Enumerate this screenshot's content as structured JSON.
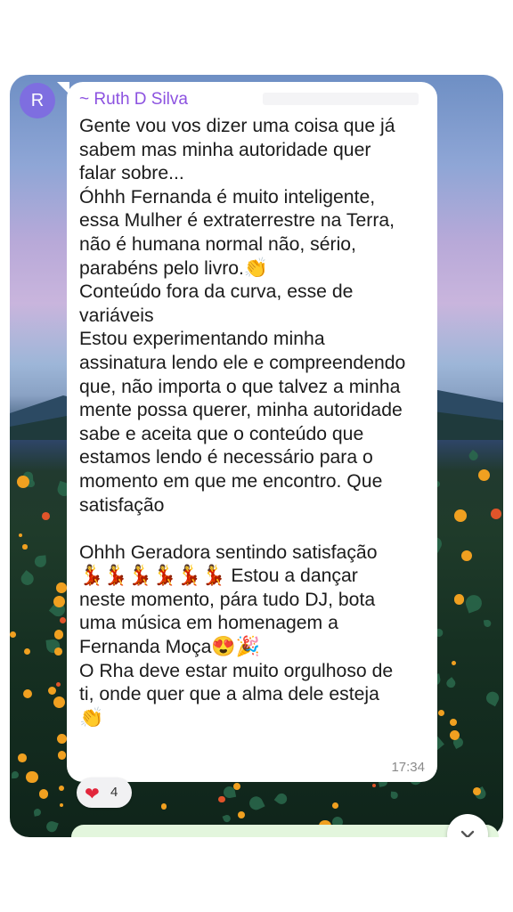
{
  "chat": {
    "avatar_initial": "R",
    "sender": "~ Ruth D Silva",
    "message_paragraphs": [
      "Gente vou vos dizer uma coisa que já\nsabem mas minha autoridade quer\nfalar sobre...",
      "Óhhh Fernanda é muito inteligente,\nessa Mulher é extraterrestre na Terra,\nnão é humana normal não, sério,\nparabéns pelo livro.",
      "Conteúdo fora da curva, esse de\nvariáveis",
      "Estou experimentando minha\nassinatura lendo ele e compreendendo\nque, não importa o que talvez a minha\nmente possa querer, minha autoridade\nsabe e aceita que o conteúdo que\nestamos lendo é necessário para o\nmomento em que me encontro. Que\nsatisfação",
      "",
      "Ohhh Geradora sentindo satisfação",
      " Estou a dançar\nneste momento, pára tudo DJ, bota\numa música em homenagem a\nFernanda Moça",
      "O Rha deve estar muito orgulhoso de\nti, onde quer que a alma dele esteja"
    ],
    "emoji": {
      "clap": "👏",
      "dancer": "💃",
      "heart_eyes": "😍",
      "party": "🎉"
    },
    "time": "17:34",
    "reaction": {
      "icon": "red-heart-icon",
      "emoji": "❤",
      "count": "4"
    }
  },
  "colors": {
    "sender": "#8c52e0",
    "avatar": "#7e6ee0",
    "bubble": "#ffffff",
    "next_bubble": "#e3f6dd"
  }
}
